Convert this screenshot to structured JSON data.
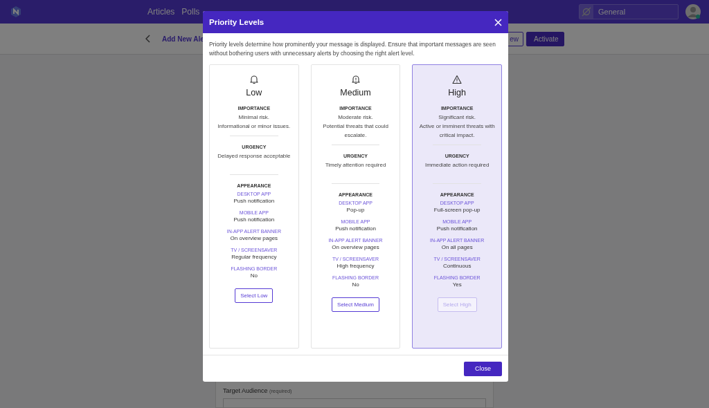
{
  "topbar": {
    "nav": [
      "Articles",
      "Polls"
    ],
    "search": {
      "value": "General"
    }
  },
  "subbar": {
    "title": "Add New Ale",
    "buttons": [
      {
        "label": "ew",
        "kind": "outline"
      },
      {
        "label": "Activate",
        "kind": "primary"
      }
    ]
  },
  "form": {
    "label": "Target Audience",
    "hint": "(required)"
  },
  "modal": {
    "title": "Priority Levels",
    "intro": "Priority levels determine how prominently your message is displayed. Ensure that important messages are seen without bothering users with unnecessary alerts by choosing the right alert level.",
    "cards": [
      {
        "kind": "low",
        "name": "Low",
        "selected": false,
        "importance_label": "IMPORTANCE",
        "importance": [
          "Minimal risk.",
          "Informational or minor issues."
        ],
        "urgency_label": "URGENCY",
        "urgency": "Delayed response acceptable",
        "appearance_label": "APPEARANCE",
        "appearance": [
          {
            "label": "DESKTOP APP",
            "value": "Push notification"
          },
          {
            "label": "MOBILE APP",
            "value": "Push notification"
          },
          {
            "label": "IN-APP ALERT BANNER",
            "value": "On overview pages"
          },
          {
            "label": "TV / SCREENSAVER",
            "value": "Regular frequency"
          },
          {
            "label": "FLASHING BORDER",
            "value": "No"
          }
        ],
        "button": "Select Low"
      },
      {
        "kind": "medium",
        "name": "Medium",
        "selected": false,
        "importance_label": "IMPORTANCE",
        "importance": [
          "Moderate risk.",
          "Potential threats that could escalate."
        ],
        "urgency_label": "URGENCY",
        "urgency": "Timely attention required",
        "appearance_label": "APPEARANCE",
        "appearance": [
          {
            "label": "DESKTOP APP",
            "value": "Pop-up"
          },
          {
            "label": "MOBILE APP",
            "value": "Push notification"
          },
          {
            "label": "IN-APP ALERT BANNER",
            "value": "On overview pages"
          },
          {
            "label": "TV / SCREENSAVER",
            "value": "High frequency"
          },
          {
            "label": "FLASHING BORDER",
            "value": "No"
          }
        ],
        "button": "Select Medium"
      },
      {
        "kind": "high",
        "name": "High",
        "selected": true,
        "importance_label": "IMPORTANCE",
        "importance": [
          "Significant risk.",
          "Active or imminent threats with critical impact."
        ],
        "urgency_label": "URGENCY",
        "urgency": "Immediate action required",
        "appearance_label": "APPEARANCE",
        "appearance": [
          {
            "label": "DESKTOP APP",
            "value": "Full-screen pop-up"
          },
          {
            "label": "MOBILE APP",
            "value": "Push notification"
          },
          {
            "label": "IN-APP ALERT BANNER",
            "value": "On all pages"
          },
          {
            "label": "TV / SCREENSAVER",
            "value": "Continuous"
          },
          {
            "label": "FLASHING BORDER",
            "value": "Yes"
          }
        ],
        "button": "Select High"
      }
    ],
    "close": "Close"
  }
}
